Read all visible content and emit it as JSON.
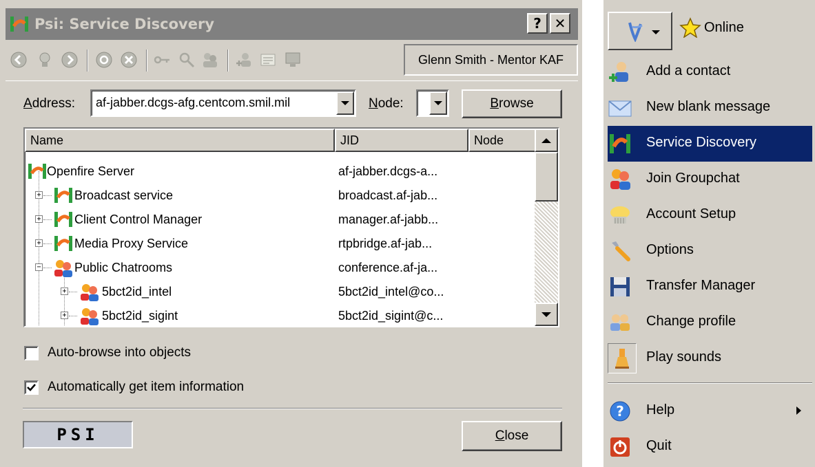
{
  "window": {
    "title": "Psi: Service Discovery",
    "help_btn": "?",
    "close_btn": "✕"
  },
  "identity": "Glenn Smith - Mentor KAF",
  "address": {
    "label": "Address:",
    "value": "af-jabber.dcgs-afg.centcom.smil.mil"
  },
  "node": {
    "label": "Node:",
    "value": ""
  },
  "browse_label": "Browse",
  "columns": [
    "Name",
    "JID",
    "Node"
  ],
  "rows": [
    {
      "name": "Openfire Server",
      "jid": "af-jabber.dcgs-a...",
      "icon": "server-icon"
    },
    {
      "name": "Broadcast service",
      "jid": "broadcast.af-jab...",
      "icon": "service-icon"
    },
    {
      "name": "Client Control Manager",
      "jid": "manager.af-jabb...",
      "icon": "service-icon"
    },
    {
      "name": "Media Proxy Service",
      "jid": "rtpbridge.af-jab...",
      "icon": "service-icon"
    },
    {
      "name": "Public Chatrooms",
      "jid": "conference.af-ja...",
      "icon": "groupchat-icon"
    },
    {
      "name": "5bct2id_intel",
      "jid": "5bct2id_intel@co...",
      "icon": "groupchat-icon"
    },
    {
      "name": "5bct2id_sigint",
      "jid": "5bct2id_sigint@c...",
      "icon": "groupchat-icon"
    }
  ],
  "options": {
    "auto_browse": {
      "label": "Auto-browse into objects",
      "checked": false
    },
    "auto_info": {
      "label": "Automatically get item information",
      "checked": true
    }
  },
  "logo": "PSI",
  "close_label": "Close",
  "menu": {
    "status": "Online",
    "items": [
      {
        "label": "Add a contact",
        "icon": "add-contact-icon"
      },
      {
        "label": "New blank message",
        "icon": "envelope-icon"
      },
      {
        "label": "Service Discovery",
        "icon": "service-discovery-icon",
        "selected": true
      },
      {
        "label": "Join Groupchat",
        "icon": "groupchat-icon"
      },
      {
        "label": "Account Setup",
        "icon": "account-setup-icon"
      },
      {
        "label": "Options",
        "icon": "wrench-icon"
      },
      {
        "label": "Transfer Manager",
        "icon": "floppy-icon"
      },
      {
        "label": "Change profile",
        "icon": "profile-icon"
      },
      {
        "label": "Play sounds",
        "icon": "sound-icon"
      },
      {
        "label": "Help",
        "icon": "help-icon",
        "submenu": true
      },
      {
        "label": "Quit",
        "icon": "quit-icon"
      }
    ]
  },
  "colors": {
    "face": "#d4d0c8",
    "selection": "#0a246a",
    "titlebar_inactive": "#808080"
  }
}
